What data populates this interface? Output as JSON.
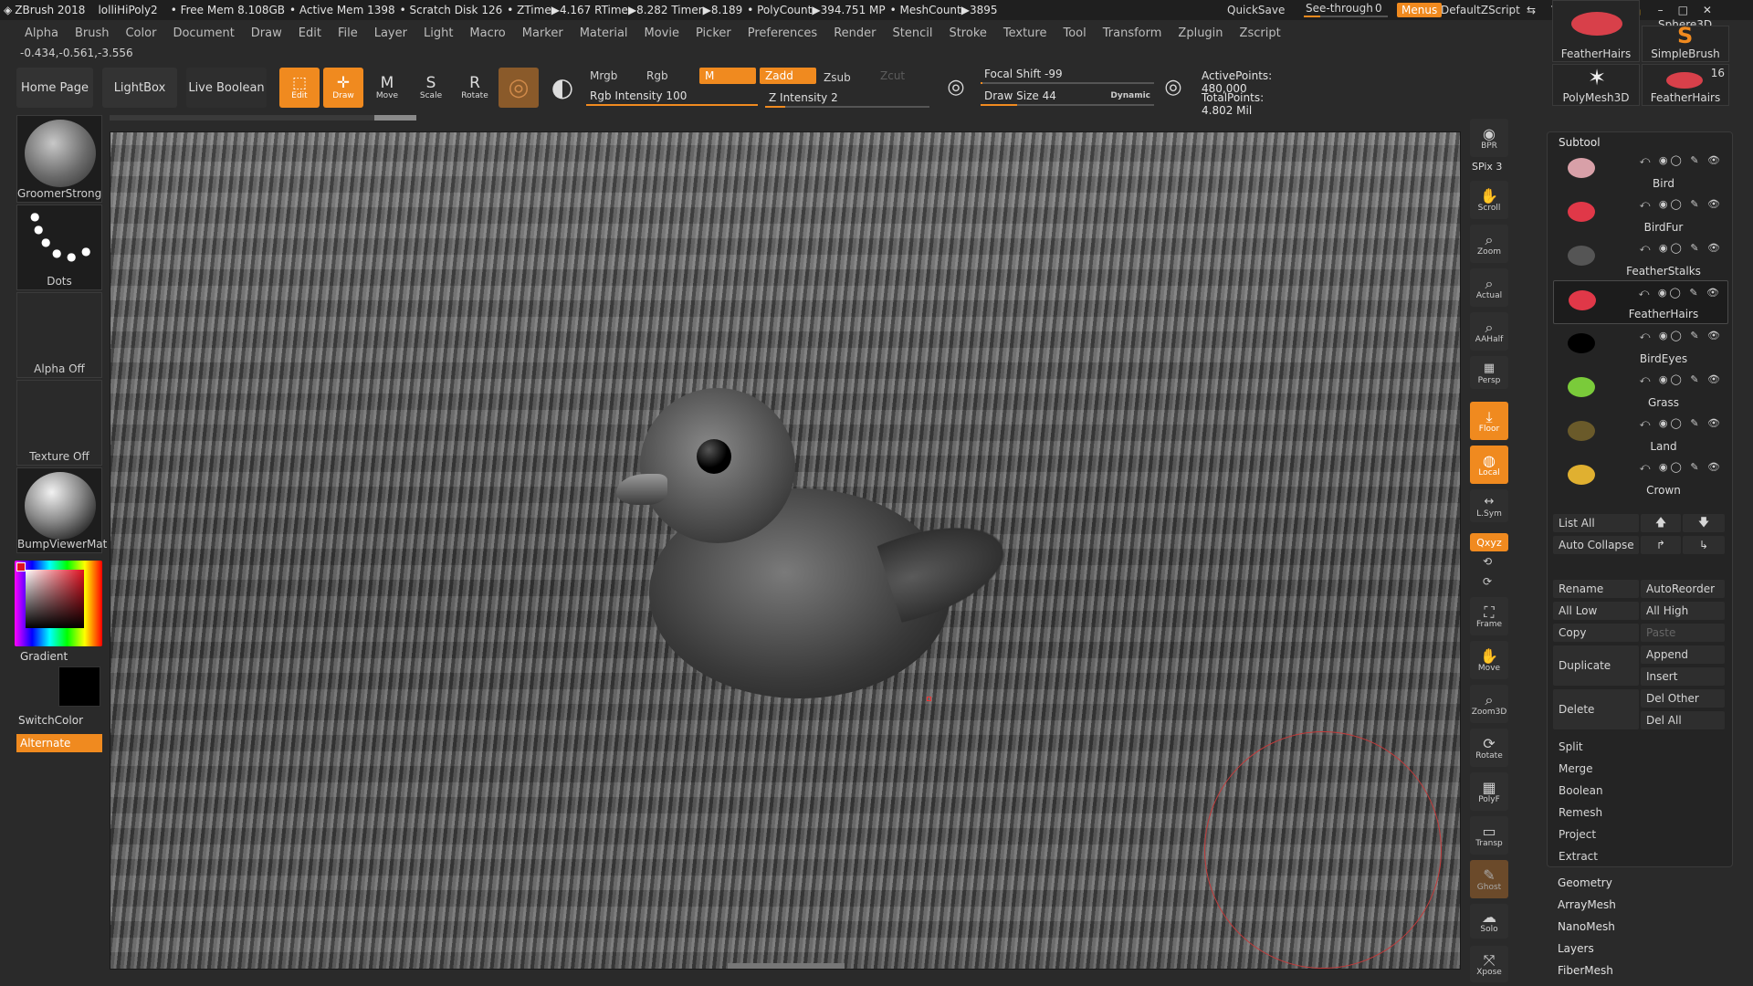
{
  "titlebar": {
    "app": "ZBrush 2018",
    "doc": "lolliHiPoly2",
    "free_mem": "• Free Mem 8.108GB",
    "active_mem": "• Active Mem 1398",
    "scratch": "• Scratch Disk 126",
    "ztime": "• ZTime▶4.167 RTime▶8.282 Timer▶8.189",
    "polycount": "• PolyCount▶394.751 MP",
    "meshcount": "• MeshCount▶3895",
    "quicksave": "QuickSave",
    "see_through_label": "See-through",
    "see_through_value": "0",
    "menus": "Menus",
    "script": "DefaultZScript"
  },
  "menubar": [
    "Alpha",
    "Brush",
    "Color",
    "Document",
    "Draw",
    "Edit",
    "File",
    "Layer",
    "Light",
    "Macro",
    "Marker",
    "Material",
    "Movie",
    "Picker",
    "Preferences",
    "Render",
    "Stencil",
    "Stroke",
    "Texture",
    "Tool",
    "Transform",
    "Zplugin",
    "Zscript"
  ],
  "coords": "-0.434,-0.561,-3.556",
  "topshelf": {
    "home": "Home Page",
    "lightbox": "LightBox",
    "liveboolean": "Live Boolean",
    "edit": "Edit",
    "draw": "Draw",
    "move": "Move",
    "scale": "Scale",
    "rotate": "Rotate",
    "mrgb": "Mrgb",
    "rgb": "Rgb",
    "m": "M",
    "zadd": "Zadd",
    "zsub": "Zsub",
    "zcut": "Zcut",
    "rgb_intensity": "Rgb Intensity 100",
    "z_intensity": "Z Intensity 2",
    "focal_shift": "Focal Shift -99",
    "draw_size": "Draw Size 44",
    "dynamic": "Dynamic",
    "active_points": "ActivePoints: 480,000",
    "total_points": "TotalPoints: 4.802 Mil"
  },
  "leftshelf": {
    "brush": "GroomerStrong",
    "stroke": "Dots",
    "alpha": "Alpha Off",
    "texture": "Texture Off",
    "material": "BumpViewerMat",
    "gradient": "Gradient",
    "switchcolor": "SwitchColor",
    "alternate": "Alternate"
  },
  "rightshelf": {
    "bpr": "BPR",
    "spix": "SPix 3",
    "scroll": "Scroll",
    "zoom": "Zoom",
    "actual": "Actual",
    "aahalf": "AAHalf",
    "dynamic_persp": "Persp",
    "floor": "Floor",
    "local": "Local",
    "lsym": "L.Sym",
    "xyz": "Qxyz",
    "frame": "Frame",
    "move": "Move",
    "zoom3d": "Zoom3D",
    "rotate": "Rotate",
    "polyf": "PolyF",
    "transp": "Transp",
    "ghost": "Ghost",
    "solo": "Solo",
    "xpose": "Xpose"
  },
  "rightpanel": {
    "brushes": [
      {
        "label": "FeatherHairs"
      },
      {
        "label": "SimpleBrush"
      },
      {
        "label": "PolyMesh3D"
      },
      {
        "label": "FeatherHairs",
        "count": "16"
      }
    ],
    "sphere3d": "Sphere3D",
    "subtool_header": "Subtool",
    "subtools": [
      "Bird",
      "BirdFur",
      "FeatherStalks",
      "FeatherHairs",
      "BirdEyes",
      "Grass",
      "Land",
      "Crown"
    ],
    "buttons": {
      "list_all": "List All",
      "auto_collapse": "Auto Collapse",
      "rename": "Rename",
      "autoreorder": "AutoReorder",
      "all_low": "All Low",
      "all_high": "All High",
      "copy": "Copy",
      "paste": "Paste",
      "duplicate": "Duplicate",
      "append": "Append",
      "insert": "Insert",
      "delete": "Delete",
      "del_other": "Del Other",
      "del_all": "Del All"
    },
    "plain": [
      "Split",
      "Merge",
      "Boolean",
      "Remesh",
      "Project",
      "Extract"
    ],
    "submenus": [
      "Geometry",
      "ArrayMesh",
      "NanoMesh",
      "Layers",
      "FiberMesh"
    ]
  },
  "colors": {
    "accent": "#f08a1f",
    "panel": "#2a2a2a",
    "brush_ring": "#c23b3b"
  }
}
